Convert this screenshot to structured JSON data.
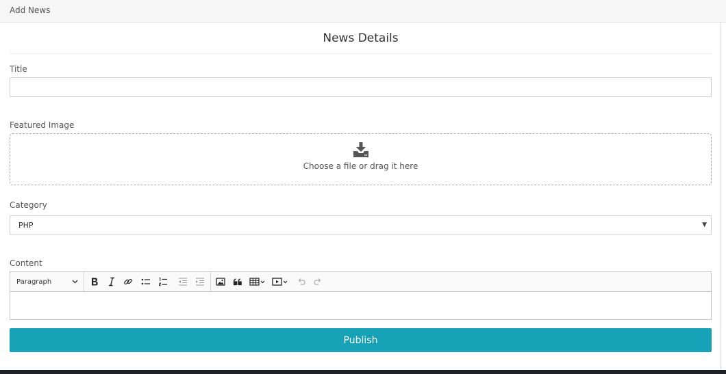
{
  "header": {
    "breadcrumb": "Add News"
  },
  "form": {
    "section_title": "News Details",
    "title_label": "Title",
    "title_value": "",
    "featured_label": "Featured Image",
    "dropzone_text": "Choose a file or drag it here",
    "category_label": "Category",
    "category_value": "PHP",
    "content_label": "Content",
    "editor": {
      "format_value": "Paragraph",
      "tools": [
        "bold-icon",
        "italic-icon",
        "link-icon",
        "bulleted-list-icon",
        "numbered-list-icon",
        "outdent-icon",
        "indent-icon",
        "image-icon",
        "blockquote-icon",
        "table-icon",
        "media-icon",
        "undo-icon",
        "redo-icon"
      ],
      "body_value": ""
    },
    "publish_label": "Publish"
  },
  "colors": {
    "accent": "#17a2b8",
    "topbar": "#f6f6f6",
    "bottombar": "#1f2226"
  }
}
